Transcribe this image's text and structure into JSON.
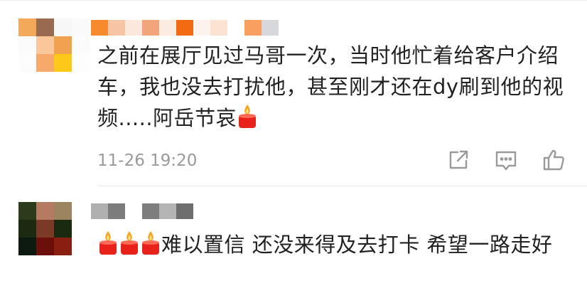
{
  "comments": [
    {
      "text": "之前在展厅见过马哥一次，当时他忙着给客户介绍车，我也没去打扰他，甚至刚才还在dy刷到他的视频.....阿岳节哀",
      "timestamp": "11-26 19:20",
      "actions": [
        "share-icon",
        "reply-icon",
        "like-icon"
      ]
    },
    {
      "text": "难以置信 还没来得及去打卡 希望一路走好",
      "leading_emoji_count": 3
    }
  ],
  "emoji": "candle-emoji",
  "colors": {
    "text": "#222222",
    "timestamp": "#9a9a9a",
    "icon": "#9a9a9a",
    "divider": "#ebebeb"
  }
}
